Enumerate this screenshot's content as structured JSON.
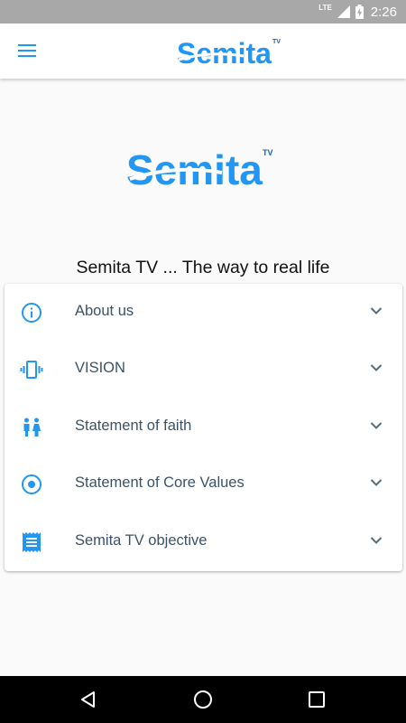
{
  "status_bar": {
    "network": "LTE",
    "time": "2:26"
  },
  "header": {
    "logo_text": "Semita",
    "logo_badge": "TV"
  },
  "brand": {
    "logo_text": "Semita",
    "logo_badge": "TV",
    "tagline": "Semita TV ... The way to real life"
  },
  "accordion": {
    "items": [
      {
        "label": "About us",
        "icon": "info-icon"
      },
      {
        "label": "VISION",
        "icon": "vibration-icon"
      },
      {
        "label": "Statement of faith",
        "icon": "people-icon"
      },
      {
        "label": "Statement of Core Values",
        "icon": "radio-target-icon"
      },
      {
        "label": "Semita TV objective",
        "icon": "document-icon"
      }
    ]
  },
  "colors": {
    "accent": "#2196f3",
    "logo_light": "#5ab2f5",
    "label": "#3b5266",
    "status_bar": "#a8a8a8",
    "nav_bar": "#000000"
  }
}
